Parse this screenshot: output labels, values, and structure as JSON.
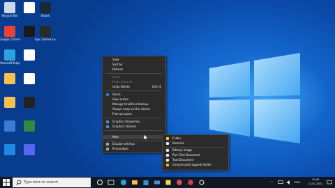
{
  "desktop_icons": [
    {
      "name": "recycle-bin",
      "label": "Recycle Bin",
      "color": "#cfd8e6"
    },
    {
      "name": "app-b",
      "label": "",
      "color": "#ffffff"
    },
    {
      "name": "steam",
      "label": "Steam",
      "color": "#1b2838"
    },
    {
      "name": "chrome",
      "label": "Google Chrome",
      "color": "#e94235"
    },
    {
      "name": "app-dark",
      "label": "",
      "color": "#1a1a1a"
    },
    {
      "name": "epic",
      "label": "Epic Games Launcher",
      "color": "#2a2a2a"
    },
    {
      "name": "edge",
      "label": "Microsoft Edge",
      "color": "#2aa3e0"
    },
    {
      "name": "file-1",
      "label": "",
      "color": "#ffffff"
    },
    {
      "name": "folder-1",
      "label": "",
      "color": "#f2c14e"
    },
    {
      "name": "app-2",
      "label": "",
      "color": "#ffffff"
    },
    {
      "name": "folder-2",
      "label": "",
      "color": "#f2c14e"
    },
    {
      "name": "obs",
      "label": "",
      "color": "#222222"
    },
    {
      "name": "app-3",
      "label": "",
      "color": "#3a7bd5"
    },
    {
      "name": "app-4",
      "label": "",
      "color": "#2f8a3e"
    },
    {
      "name": "app-5",
      "label": "",
      "color": "#1e88e5"
    },
    {
      "name": "discord",
      "label": "",
      "color": "#5865f2"
    }
  ],
  "context_menu": {
    "items": [
      {
        "label": "View",
        "arrow": "›"
      },
      {
        "label": "Sort by",
        "arrow": "›"
      },
      {
        "label": "Refresh"
      },
      {
        "label": "Paste",
        "disabled": true
      },
      {
        "label": "Paste shortcut",
        "disabled": true
      },
      {
        "label": "Undo Delete",
        "shortcut": "Ctrl+Z"
      },
      {
        "label": "Share"
      },
      {
        "label": "View online"
      },
      {
        "label": "Manage OneDrive backup"
      },
      {
        "label": "Always keep on this device"
      },
      {
        "label": "Free up space"
      },
      {
        "label": "Graphics Properties..."
      },
      {
        "label": "Graphics Options",
        "arrow": "›"
      },
      {
        "label": "New",
        "arrow": "›"
      },
      {
        "label": "Display settings"
      },
      {
        "label": "Personalize"
      }
    ]
  },
  "new_submenu": {
    "items": [
      {
        "label": "Folder"
      },
      {
        "label": "Shortcut"
      },
      {
        "label": "Bitmap image"
      },
      {
        "label": "Rich Text Document"
      },
      {
        "label": "Text Document"
      },
      {
        "label": "Compressed (zipped) Folder"
      }
    ]
  },
  "taskbar": {
    "search_placeholder": "Type here to search",
    "time": "12:45",
    "date": "10-01-2021",
    "lang": "ENG"
  },
  "colors": {
    "menu_bg": "#2b2b2b",
    "taskbar_bg": "#101923",
    "desktop_blue": "#1262c8"
  }
}
